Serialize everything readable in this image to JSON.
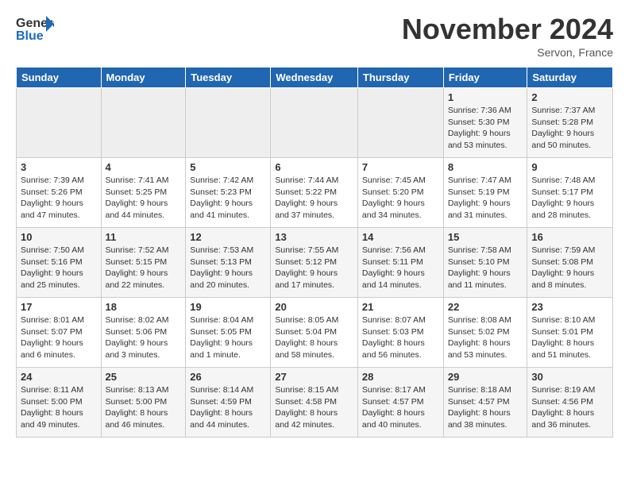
{
  "header": {
    "logo_line1": "General",
    "logo_line2": "Blue",
    "month": "November 2024",
    "location": "Servon, France"
  },
  "weekdays": [
    "Sunday",
    "Monday",
    "Tuesday",
    "Wednesday",
    "Thursday",
    "Friday",
    "Saturday"
  ],
  "weeks": [
    [
      {
        "day": "",
        "info": ""
      },
      {
        "day": "",
        "info": ""
      },
      {
        "day": "",
        "info": ""
      },
      {
        "day": "",
        "info": ""
      },
      {
        "day": "",
        "info": ""
      },
      {
        "day": "1",
        "info": "Sunrise: 7:36 AM\nSunset: 5:30 PM\nDaylight: 9 hours\nand 53 minutes."
      },
      {
        "day": "2",
        "info": "Sunrise: 7:37 AM\nSunset: 5:28 PM\nDaylight: 9 hours\nand 50 minutes."
      }
    ],
    [
      {
        "day": "3",
        "info": "Sunrise: 7:39 AM\nSunset: 5:26 PM\nDaylight: 9 hours\nand 47 minutes."
      },
      {
        "day": "4",
        "info": "Sunrise: 7:41 AM\nSunset: 5:25 PM\nDaylight: 9 hours\nand 44 minutes."
      },
      {
        "day": "5",
        "info": "Sunrise: 7:42 AM\nSunset: 5:23 PM\nDaylight: 9 hours\nand 41 minutes."
      },
      {
        "day": "6",
        "info": "Sunrise: 7:44 AM\nSunset: 5:22 PM\nDaylight: 9 hours\nand 37 minutes."
      },
      {
        "day": "7",
        "info": "Sunrise: 7:45 AM\nSunset: 5:20 PM\nDaylight: 9 hours\nand 34 minutes."
      },
      {
        "day": "8",
        "info": "Sunrise: 7:47 AM\nSunset: 5:19 PM\nDaylight: 9 hours\nand 31 minutes."
      },
      {
        "day": "9",
        "info": "Sunrise: 7:48 AM\nSunset: 5:17 PM\nDaylight: 9 hours\nand 28 minutes."
      }
    ],
    [
      {
        "day": "10",
        "info": "Sunrise: 7:50 AM\nSunset: 5:16 PM\nDaylight: 9 hours\nand 25 minutes."
      },
      {
        "day": "11",
        "info": "Sunrise: 7:52 AM\nSunset: 5:15 PM\nDaylight: 9 hours\nand 22 minutes."
      },
      {
        "day": "12",
        "info": "Sunrise: 7:53 AM\nSunset: 5:13 PM\nDaylight: 9 hours\nand 20 minutes."
      },
      {
        "day": "13",
        "info": "Sunrise: 7:55 AM\nSunset: 5:12 PM\nDaylight: 9 hours\nand 17 minutes."
      },
      {
        "day": "14",
        "info": "Sunrise: 7:56 AM\nSunset: 5:11 PM\nDaylight: 9 hours\nand 14 minutes."
      },
      {
        "day": "15",
        "info": "Sunrise: 7:58 AM\nSunset: 5:10 PM\nDaylight: 9 hours\nand 11 minutes."
      },
      {
        "day": "16",
        "info": "Sunrise: 7:59 AM\nSunset: 5:08 PM\nDaylight: 9 hours\nand 8 minutes."
      }
    ],
    [
      {
        "day": "17",
        "info": "Sunrise: 8:01 AM\nSunset: 5:07 PM\nDaylight: 9 hours\nand 6 minutes."
      },
      {
        "day": "18",
        "info": "Sunrise: 8:02 AM\nSunset: 5:06 PM\nDaylight: 9 hours\nand 3 minutes."
      },
      {
        "day": "19",
        "info": "Sunrise: 8:04 AM\nSunset: 5:05 PM\nDaylight: 9 hours\nand 1 minute."
      },
      {
        "day": "20",
        "info": "Sunrise: 8:05 AM\nSunset: 5:04 PM\nDaylight: 8 hours\nand 58 minutes."
      },
      {
        "day": "21",
        "info": "Sunrise: 8:07 AM\nSunset: 5:03 PM\nDaylight: 8 hours\nand 56 minutes."
      },
      {
        "day": "22",
        "info": "Sunrise: 8:08 AM\nSunset: 5:02 PM\nDaylight: 8 hours\nand 53 minutes."
      },
      {
        "day": "23",
        "info": "Sunrise: 8:10 AM\nSunset: 5:01 PM\nDaylight: 8 hours\nand 51 minutes."
      }
    ],
    [
      {
        "day": "24",
        "info": "Sunrise: 8:11 AM\nSunset: 5:00 PM\nDaylight: 8 hours\nand 49 minutes."
      },
      {
        "day": "25",
        "info": "Sunrise: 8:13 AM\nSunset: 5:00 PM\nDaylight: 8 hours\nand 46 minutes."
      },
      {
        "day": "26",
        "info": "Sunrise: 8:14 AM\nSunset: 4:59 PM\nDaylight: 8 hours\nand 44 minutes."
      },
      {
        "day": "27",
        "info": "Sunrise: 8:15 AM\nSunset: 4:58 PM\nDaylight: 8 hours\nand 42 minutes."
      },
      {
        "day": "28",
        "info": "Sunrise: 8:17 AM\nSunset: 4:57 PM\nDaylight: 8 hours\nand 40 minutes."
      },
      {
        "day": "29",
        "info": "Sunrise: 8:18 AM\nSunset: 4:57 PM\nDaylight: 8 hours\nand 38 minutes."
      },
      {
        "day": "30",
        "info": "Sunrise: 8:19 AM\nSunset: 4:56 PM\nDaylight: 8 hours\nand 36 minutes."
      }
    ]
  ]
}
